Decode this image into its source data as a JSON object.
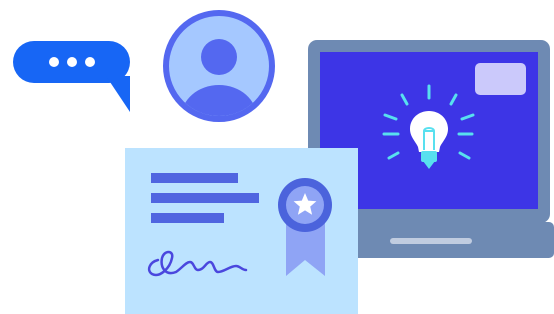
{
  "illustration": {
    "chat_bubble": {
      "icon": "ellipsis-icon",
      "color": "#1766F5"
    },
    "avatar": {
      "icon": "user-icon",
      "ring_color": "#5468F0",
      "fill_color": "#A5C8FF"
    },
    "laptop": {
      "frame_color": "#6E8AB3",
      "screen_color": "#3D35E6",
      "icon": "lightbulb-icon",
      "accent_color": "#58E0EF"
    },
    "certificate": {
      "paper_color": "#BCE3FF",
      "text_line_color": "#5065E0",
      "badge_icon": "star-icon",
      "ribbon_color": "#8FA4F5",
      "signature": "handwritten-signature"
    }
  }
}
